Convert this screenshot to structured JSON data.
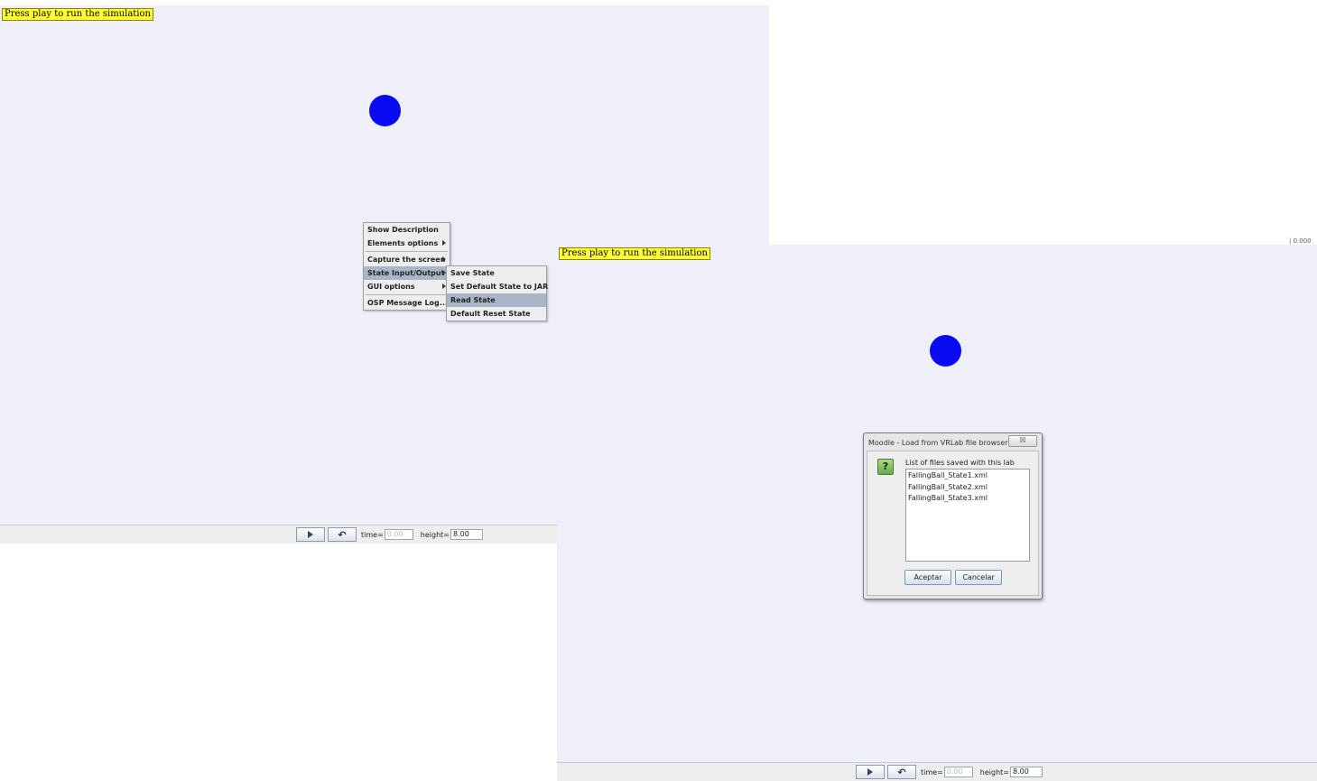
{
  "window_left": {
    "banner": "Press play to run the simulation",
    "context_menu": {
      "items": [
        {
          "label": "Show Description"
        },
        {
          "label": "Elements options"
        },
        {
          "label": "Capture the screen"
        },
        {
          "label": "State Input/Output"
        },
        {
          "label": "GUI options"
        },
        {
          "label": "OSP Message Log..."
        }
      ]
    },
    "submenu": {
      "items": [
        {
          "label": "Save State"
        },
        {
          "label": "Set Default State to JAR"
        },
        {
          "label": "Read State"
        },
        {
          "label": "Default Reset State"
        }
      ]
    },
    "controls": {
      "time_label": "time=",
      "time_value": "0.00",
      "height_label": "height=",
      "height_value": "8.00"
    }
  },
  "window_right": {
    "banner": "Press play to run the simulation",
    "dialog": {
      "title": "Moodle - Load from VRLab file browser",
      "close_glyph": "☒",
      "icon": "?",
      "list_caption": "List of files saved with this lab",
      "files": [
        "FallingBall_State1.xml",
        "FallingBall_State2.xml",
        "FallingBall_State3.xml"
      ],
      "ok_label": "Aceptar",
      "cancel_label": "Cancelar"
    },
    "controls": {
      "time_label": "time=",
      "time_value": "0.00",
      "height_label": "height=",
      "height_value": "8.00"
    }
  },
  "edge_text": "| 0.000",
  "colors": {
    "sim_background": "#efeffa",
    "ball": "#0a0af0",
    "banner": "#ffff33",
    "menu_highlight": "#a8b6c8"
  }
}
